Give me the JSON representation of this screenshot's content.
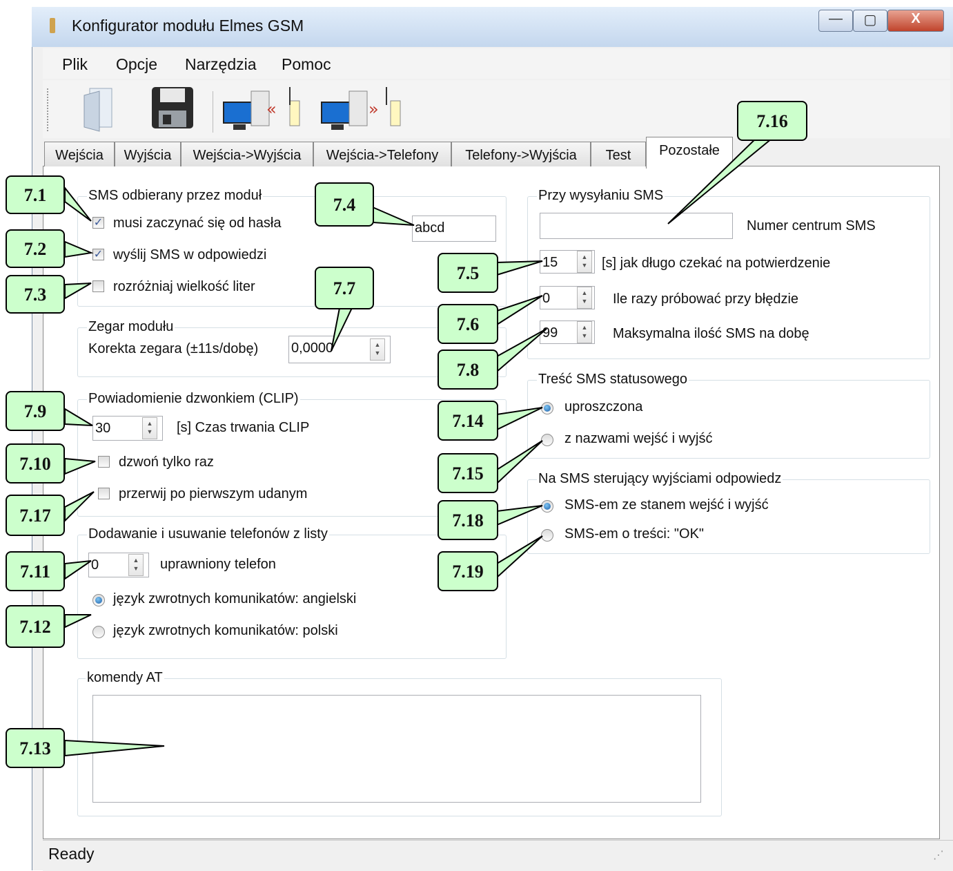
{
  "window": {
    "title": "Konfigurator modułu Elmes GSM",
    "min_glyph": "—",
    "max_glyph": "▢",
    "close_glyph": "X"
  },
  "menu": [
    "Plik",
    "Opcje",
    "Narzędzia",
    "Pomoc"
  ],
  "toolbar": {
    "icons": [
      "open-file-icon",
      "save-disk-icon",
      "read-from-module-icon",
      "write-to-module-icon"
    ]
  },
  "tabs": [
    "Wejścia",
    "Wyjścia",
    "Wejścia->Wyjścia",
    "Wejścia->Telefony",
    "Telefony->Wyjścia",
    "Test",
    "Pozostałe"
  ],
  "active_tab": "Pozostałe",
  "sms_received": {
    "legend": "SMS odbierany przez moduł",
    "must_start_with_password": {
      "label": "musi zaczynać się od hasła",
      "checked": true
    },
    "send_reply": {
      "label": "wyślij SMS w odpowiedzi",
      "checked": true
    },
    "case_sensitive": {
      "label": "rozróżniaj wielkość liter",
      "checked": false
    },
    "password": "abcd"
  },
  "clock": {
    "legend": "Zegar modułu",
    "correction_label": "Korekta zegara (±11s/dobę)",
    "correction_value": "0,0000"
  },
  "clip": {
    "legend": "Powiadomienie dzwonkiem (CLIP)",
    "duration_value": "30",
    "duration_label": "[s]  Czas trwania CLIP",
    "ring_once": {
      "label": "dzwoń tylko raz",
      "checked": false
    },
    "stop_after_first": {
      "label": "przerwij po pierwszym udanym",
      "checked": false
    }
  },
  "phones": {
    "legend": "Dodawanie i usuwanie telefonów z listy",
    "authorized_value": "0",
    "authorized_label": "uprawniony telefon",
    "lang_english": {
      "label": "język zwrotnych komunikatów: angielski",
      "selected": true
    },
    "lang_polish": {
      "label": "język zwrotnych komunikatów: polski",
      "selected": false
    }
  },
  "at": {
    "legend": "komendy AT",
    "text": ""
  },
  "sending": {
    "legend": "Przy wysyłaniu SMS",
    "center_value": "",
    "center_label": "Numer centrum SMS",
    "wait_value": "15",
    "wait_label": "[s]  jak długo czekać na potwierdzenie",
    "retries_value": "0",
    "retries_label": "Ile razy próbować przy błędzie",
    "max_value": "99",
    "max_label": "Maksymalna ilość SMS na dobę"
  },
  "status_sms": {
    "legend": "Treść SMS statusowego",
    "simple": {
      "label": "uproszczona",
      "selected": true
    },
    "with_names": {
      "label": "z nazwami wejść i wyjść",
      "selected": false
    }
  },
  "reply_control": {
    "legend": "Na SMS sterujący wyjściami odpowiedz",
    "with_state": {
      "label": "SMS-em ze stanem wejść i wyjść",
      "selected": true
    },
    "ok": {
      "label": "SMS-em o treści: \"OK\"",
      "selected": false
    }
  },
  "callouts": [
    "7.1",
    "7.2",
    "7.3",
    "7.4",
    "7.5",
    "7.6",
    "7.7",
    "7.8",
    "7.9",
    "7.10",
    "7.11",
    "7.12",
    "7.13",
    "7.14",
    "7.15",
    "7.16",
    "7.17",
    "7.18",
    "7.19"
  ],
  "status_bar": {
    "text": "Ready"
  },
  "colors": {
    "callout_fill": "#ccffcc",
    "titlebar": "#c4d7ee",
    "close_button": "#c0432b",
    "radio_on": "#1e5fa8"
  }
}
